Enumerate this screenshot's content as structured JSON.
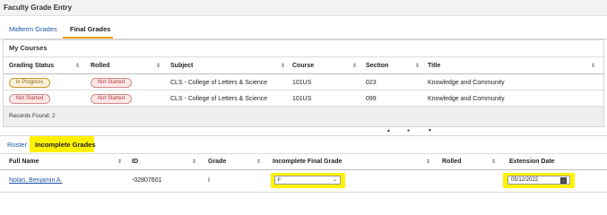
{
  "page": {
    "title": "Faculty Grade Entry",
    "tabs": [
      {
        "label": "Midterm Grades",
        "active": false
      },
      {
        "label": "Final Grades",
        "active": true
      }
    ]
  },
  "my_courses": {
    "heading": "My Courses",
    "columns": [
      "Grading Status",
      "Rolled",
      "Subject",
      "Course",
      "Section",
      "Title"
    ],
    "rows": [
      {
        "status": "In Progress",
        "rolled": "Not Started",
        "subject": "CLS - College of Letters & Science",
        "course": "101US",
        "section": "023",
        "title": "Knowledge and Community"
      },
      {
        "status": "Not Started",
        "rolled": "Not Started",
        "subject": "CLS - College of Letters & Science",
        "course": "101US",
        "section": "099",
        "title": "Knowledge and Community"
      }
    ],
    "records_found": "Records Found: 2"
  },
  "pager": {
    "up": "▲",
    "dot": "●",
    "down": "▼"
  },
  "detail": {
    "tabs": [
      {
        "label": "Roster",
        "active": false
      },
      {
        "label": "Incomplete Grades",
        "active": true
      }
    ],
    "columns": [
      "Full Name",
      "ID",
      "Grade",
      "Incomplete Final Grade",
      "Rolled",
      "Extension Date"
    ],
    "rows": [
      {
        "name": "Nolan, Benjamin A.",
        "id": "-02807601",
        "grade": "I",
        "incomplete_final_grade": "F",
        "rolled": "",
        "extension_date": "05/12/2022"
      }
    ]
  },
  "colors": {
    "accent": "#e8a21b",
    "highlight": "#fff200",
    "link": "#1d55a8",
    "in_progress": "#c89a2c",
    "not_started": "#d68a8a"
  },
  "icons": {
    "sort": "sort-icon",
    "dropdown": "chevron-down-icon",
    "calendar": "calendar-icon"
  }
}
